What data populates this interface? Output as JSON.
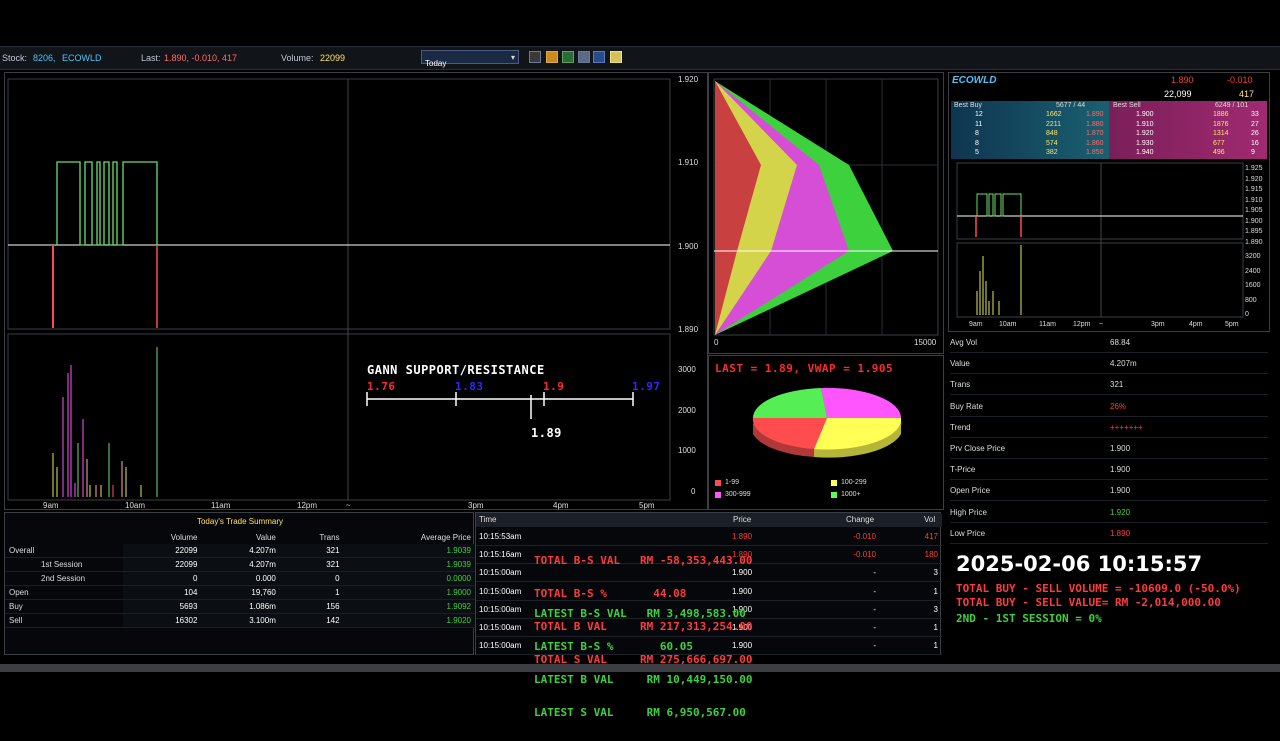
{
  "toolbar": {
    "stock_label": "Stock:",
    "stock_code": "8206,",
    "stock_name": "ECOWLD",
    "last_label": "Last:",
    "last_value": "1.890, -0.010, 417",
    "volume_label": "Volume:",
    "volume_value": "22099",
    "period_select": "Today",
    "icons": [
      "chart-icon",
      "folder-icon",
      "refresh-icon",
      "delete-icon",
      "save-icon",
      "note-icon"
    ]
  },
  "main_chart": {
    "y_ticks": [
      "1.920",
      "1.910",
      "1.900",
      "1.890"
    ],
    "volume_ticks": [
      "3000",
      "2000",
      "1000",
      "0"
    ],
    "x_ticks": [
      "9am",
      "10am",
      "11am",
      "12pm",
      "~",
      "3pm",
      "4pm",
      "5pm"
    ],
    "gann": {
      "title": "GANN SUPPORT/RESISTANCE",
      "levels": [
        "1.76",
        "1.83",
        "1.9",
        "1.97"
      ],
      "level_colors": [
        "#ff2b2b",
        "#2b2bff",
        "#ff2b2b",
        "#2b2bff"
      ],
      "current": "1.89"
    }
  },
  "volume_profile": {
    "x_ticks": [
      "0",
      "15000"
    ]
  },
  "pie": {
    "title": "LAST = 1.89, VWAP = 1.905",
    "legend": [
      {
        "label": "1-99",
        "color": "#ff4d4d"
      },
      {
        "label": "100-299",
        "color": "#ffff55"
      },
      {
        "label": "300-999",
        "color": "#ff55ff"
      },
      {
        "label": "1000+",
        "color": "#55ff55"
      }
    ]
  },
  "quote": {
    "name": "ECOWLD",
    "last": "1.890",
    "change": "-0.010",
    "volume": "22,099",
    "trades": "417",
    "best_buy_label": "Best Buy",
    "best_buy_summary": "5677 / 44",
    "best_sell_label": "Best Sell",
    "best_sell_summary": "6249 / 101",
    "depth": [
      {
        "bq": "12",
        "bv": "1662",
        "bp": "1.890",
        "sp": "1.900",
        "sv": "1886",
        "sq": "33"
      },
      {
        "bq": "11",
        "bv": "2211",
        "bp": "1.880",
        "sp": "1.910",
        "sv": "1876",
        "sq": "27"
      },
      {
        "bq": "8",
        "bv": "848",
        "bp": "1.870",
        "sp": "1.920",
        "sv": "1314",
        "sq": "26"
      },
      {
        "bq": "8",
        "bv": "574",
        "bp": "1.860",
        "sp": "1.930",
        "sv": "677",
        "sq": "16"
      },
      {
        "bq": "5",
        "bv": "382",
        "bp": "1.850",
        "sp": "1.940",
        "sv": "496",
        "sq": "9"
      }
    ],
    "mini_y_ticks": [
      "1.925",
      "1.920",
      "1.915",
      "1.910",
      "1.905",
      "1.900",
      "1.895",
      "1.890"
    ],
    "mini_vol_ticks": [
      "3200",
      "2400",
      "1600",
      "800",
      "0"
    ],
    "mini_x_ticks": [
      "9am",
      "10am",
      "11am",
      "12pm",
      "~",
      "3pm",
      "4pm",
      "5pm"
    ]
  },
  "stats": [
    {
      "k": "Avg Vol",
      "v": "68.84"
    },
    {
      "k": "Value",
      "v": "4.207m"
    },
    {
      "k": "Trans",
      "v": "321"
    },
    {
      "k": "Buy Rate",
      "v": "26%"
    },
    {
      "k": "Trend",
      "v": "+++++++"
    },
    {
      "k": "Prv Close Price",
      "v": "1.900"
    },
    {
      "k": "T-Price",
      "v": "1.900"
    },
    {
      "k": "Open Price",
      "v": "1.900"
    },
    {
      "k": "High Price",
      "v": "1.920"
    },
    {
      "k": "Low Price",
      "v": "1.890"
    }
  ],
  "summary": {
    "title": "Today's Trade Summary",
    "headers": [
      "Volume",
      "Value",
      "Trans",
      "Average Price"
    ],
    "rows": [
      {
        "name": "Overall",
        "vol": "22099",
        "val": "4.207m",
        "trans": "321",
        "avg": "1.9039"
      },
      {
        "name": "1st Session",
        "vol": "22099",
        "val": "4.207m",
        "trans": "321",
        "avg": "1.9039"
      },
      {
        "name": "2nd Session",
        "vol": "0",
        "val": "0.000",
        "trans": "0",
        "avg": "0.0000"
      },
      {
        "name": "Open",
        "vol": "104",
        "val": "19,760",
        "trans": "1",
        "avg": "1.9000"
      },
      {
        "name": "Buy",
        "vol": "5693",
        "val": "1.086m",
        "trans": "156",
        "avg": "1.9092"
      },
      {
        "name": "Sell",
        "vol": "16302",
        "val": "3.100m",
        "trans": "142",
        "avg": "1.9020"
      }
    ]
  },
  "trades": {
    "headers": [
      "Time",
      "Price",
      "Change",
      "Vol"
    ],
    "rows": [
      {
        "time": "10:15:53am",
        "price": "1.890",
        "change": "-0.010",
        "vol": "417",
        "c": "r"
      },
      {
        "time": "10:15:16am",
        "price": "1.890",
        "change": "-0.010",
        "vol": "180",
        "c": "r"
      },
      {
        "time": "10:15:00am",
        "price": "1.900",
        "change": "-",
        "vol": "3",
        "c": "w"
      },
      {
        "time": "10:15:00am",
        "price": "1.900",
        "change": "-",
        "vol": "1",
        "c": "w"
      },
      {
        "time": "10:15:00am",
        "price": "1.900",
        "change": "-",
        "vol": "3",
        "c": "w"
      },
      {
        "time": "10:15:00am",
        "price": "1.900",
        "change": "-",
        "vol": "1",
        "c": "w"
      },
      {
        "time": "10:15:00am",
        "price": "1.900",
        "change": "-",
        "vol": "1",
        "c": "w"
      }
    ],
    "overlay_red": [
      "TOTAL B-S VAL   RM -58,353,443.00",
      "TOTAL B-S %       44.08",
      "TOTAL B VAL     RM 217,313,254.00",
      "TOTAL S VAL     RM 275,666,697.00"
    ],
    "overlay_green": [
      "LATEST B-S VAL   RM 3,498,583.00",
      "LATEST B-S %       60.05",
      "LATEST B VAL     RM 10,449,150.00",
      "LATEST S VAL     RM 6,950,567.00"
    ]
  },
  "clock": {
    "datetime": "2025-02-06 10:15:57",
    "line1": "TOTAL BUY - SELL VOLUME = -10609.0 (-50.0%)",
    "line2": "TOTAL BUY - SELL VALUE= RM -2,014,000.00",
    "line3": "2ND - 1ST SESSION = 0%"
  }
}
